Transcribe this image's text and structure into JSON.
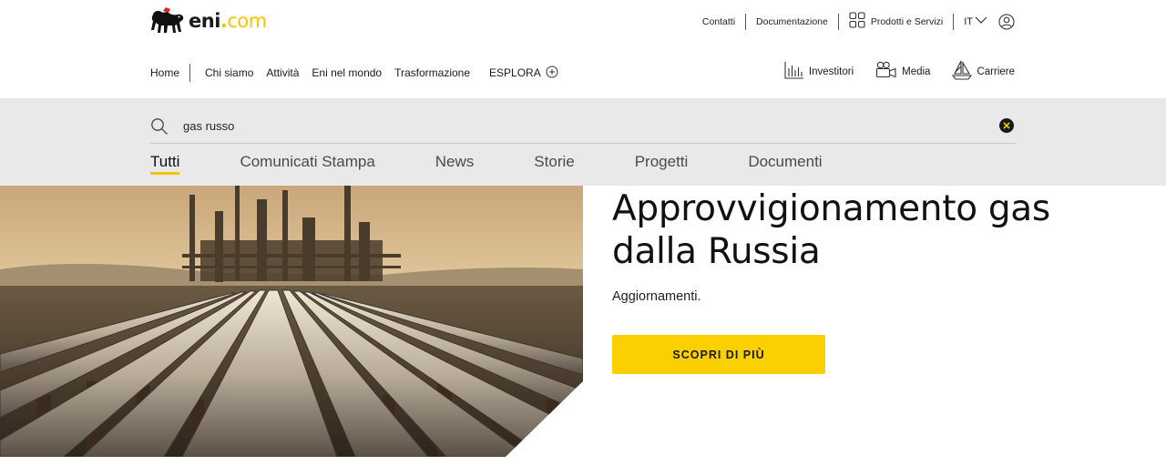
{
  "brand": {
    "name_main": "eni",
    "name_dot": ".",
    "name_suffix": "com",
    "accent_color": "#fcd000",
    "logo_icon": "six-legged-dog-icon"
  },
  "utility_nav": {
    "contacts": "Contatti",
    "documentation": "Documentazione",
    "products": "Prodotti e Servizi",
    "language": "IT",
    "user_icon": "user-icon"
  },
  "main_nav": {
    "items": [
      "Home",
      "Chi siamo",
      "Attività",
      "Eni nel mondo",
      "Trasformazione"
    ],
    "explore": "ESPLORA",
    "right": [
      {
        "label": "Investitori",
        "icon": "bar-chart-icon"
      },
      {
        "label": "Media",
        "icon": "camera-icon"
      },
      {
        "label": "Carriere",
        "icon": "sailboat-icon"
      }
    ]
  },
  "search": {
    "value": "gas russo",
    "icon": "search-icon",
    "clear_icon": "clear-icon"
  },
  "tabs": [
    {
      "label": "Tutti",
      "active": true
    },
    {
      "label": "Comunicati Stampa",
      "active": false
    },
    {
      "label": "News",
      "active": false
    },
    {
      "label": "Storie",
      "active": false
    },
    {
      "label": "Progetti",
      "active": false
    },
    {
      "label": "Documenti",
      "active": false
    }
  ],
  "hero": {
    "title": "Approvvigionamento gas dalla Russia",
    "subtitle": "Aggiornamenti.",
    "cta": "SCOPRI DI PIÙ"
  }
}
